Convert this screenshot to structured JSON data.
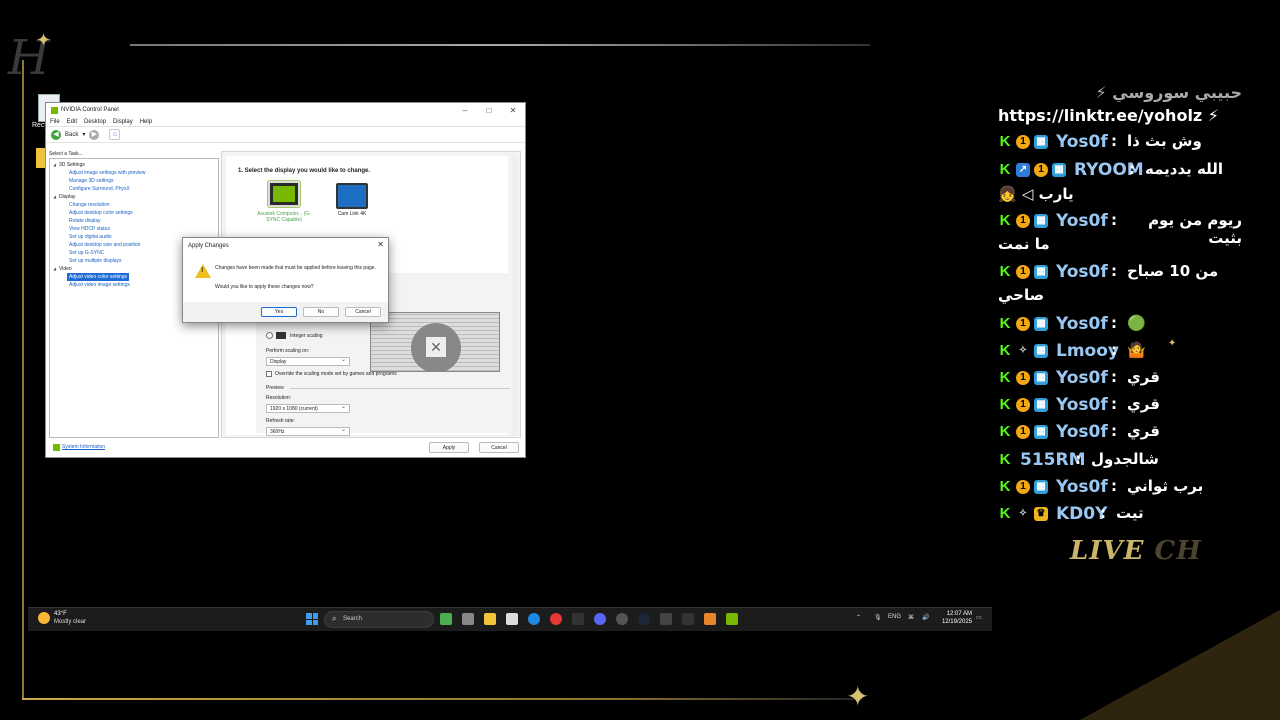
{
  "overlay": {
    "live_chat_1": "LIVE",
    "live_chat_2": "CH"
  },
  "desktop": {
    "icon_label": "Recy"
  },
  "nvidia": {
    "title": "NVIDIA Control Panel",
    "menu": [
      "File",
      "Edit",
      "Desktop",
      "Display",
      "Help"
    ],
    "back_label": "Back",
    "task_label": "Select a Task...",
    "tree": [
      {
        "type": "cat",
        "label": "3D Settings"
      },
      {
        "type": "item",
        "label": "Adjust image settings with preview"
      },
      {
        "type": "item",
        "label": "Manage 3D settings"
      },
      {
        "type": "item",
        "label": "Configure Surround, PhysX"
      },
      {
        "type": "cat",
        "label": "Display"
      },
      {
        "type": "item",
        "label": "Change resolution"
      },
      {
        "type": "item",
        "label": "Adjust desktop color settings"
      },
      {
        "type": "item",
        "label": "Rotate display"
      },
      {
        "type": "item",
        "label": "View HDCP status"
      },
      {
        "type": "item",
        "label": "Set up digital audio"
      },
      {
        "type": "item",
        "label": "Adjust desktop size and position"
      },
      {
        "type": "item",
        "label": "Set up G-SYNC"
      },
      {
        "type": "item",
        "label": "Set up multiple displays"
      },
      {
        "type": "cat",
        "label": "Video"
      },
      {
        "type": "item",
        "label": "Adjust video color settings",
        "selected": true
      },
      {
        "type": "item",
        "label": "Adjust video image settings"
      }
    ],
    "step_title": "1. Select the display you would like to change.",
    "display1_label": "Asustek Computer... (G-SYNC Capable)",
    "display2_label": "Cam Link 4K",
    "integer_scaling": "Integer scaling",
    "perform_scaling_label": "Perform scaling on:",
    "perform_scaling_value": "Display",
    "override_label": "Override the scaling mode set by games and programs",
    "preview_label": "Preview",
    "resolution_label": "Resolution:",
    "resolution_value": "1920 x 1080 (current)",
    "refresh_label": "Refresh rate:",
    "refresh_value": "360Hz",
    "system_info": "System Information",
    "apply": "Apply",
    "cancel": "Cancel"
  },
  "dialog": {
    "title": "Apply Changes",
    "message1": "Changes have been made that must be applied before leaving this page.",
    "message2": "Would you like to apply these changes now?",
    "yes": "Yes",
    "no": "No",
    "cancel": "Cancel"
  },
  "taskbar": {
    "temp": "43°F",
    "weather": "Mostly clear",
    "search_placeholder": "Search",
    "lang": "ENG",
    "time": "12:07 AM",
    "date": "12/19/2025"
  },
  "chat": {
    "top_partial": "حبيبي سوروسي ⚡",
    "link_line": "https://linktr.ee/yoholz ⚡",
    "messages": [
      {
        "user": "Yos0f",
        "text": "وش بث ذا",
        "badges": [
          "k",
          "one",
          "sub"
        ]
      },
      {
        "user": "RYOOM",
        "text": "الله يدديمه",
        "badges": [
          "k",
          "blue",
          "one",
          "sub"
        ]
      },
      {
        "user": "",
        "text": "يارب ◁ 👧",
        "badges": []
      },
      {
        "user": "Yos0f",
        "text": "ريوم من يوم بثيت",
        "badges": [
          "k",
          "one",
          "sub"
        ]
      },
      {
        "user": "",
        "text": "ما نمت",
        "badges": []
      },
      {
        "user": "Yos0f",
        "text": "من 10 صباح",
        "badges": [
          "k",
          "one",
          "sub"
        ]
      },
      {
        "user": "",
        "text": "صاحي",
        "badges": []
      },
      {
        "user": "Yos0f",
        "text": "🟢",
        "badges": [
          "k",
          "one",
          "sub"
        ]
      },
      {
        "user": "Lmooy",
        "text": "🤷",
        "badges": [
          "k",
          "wave",
          "sub"
        ]
      },
      {
        "user": "Yos0f",
        "text": "قري",
        "badges": [
          "k",
          "one",
          "sub"
        ]
      },
      {
        "user": "Yos0f",
        "text": "قري",
        "badges": [
          "k",
          "one",
          "sub"
        ]
      },
      {
        "user": "Yos0f",
        "text": "قري",
        "badges": [
          "k",
          "one",
          "sub"
        ]
      },
      {
        "user": "515RM",
        "text": "شالجدول",
        "badges": [
          "k"
        ]
      },
      {
        "user": "Yos0f",
        "text": "برب ثواني",
        "badges": [
          "k",
          "one",
          "sub"
        ]
      },
      {
        "user": "KD0Y",
        "text": "تيت",
        "badges": [
          "k",
          "wave",
          "crown"
        ]
      }
    ]
  }
}
